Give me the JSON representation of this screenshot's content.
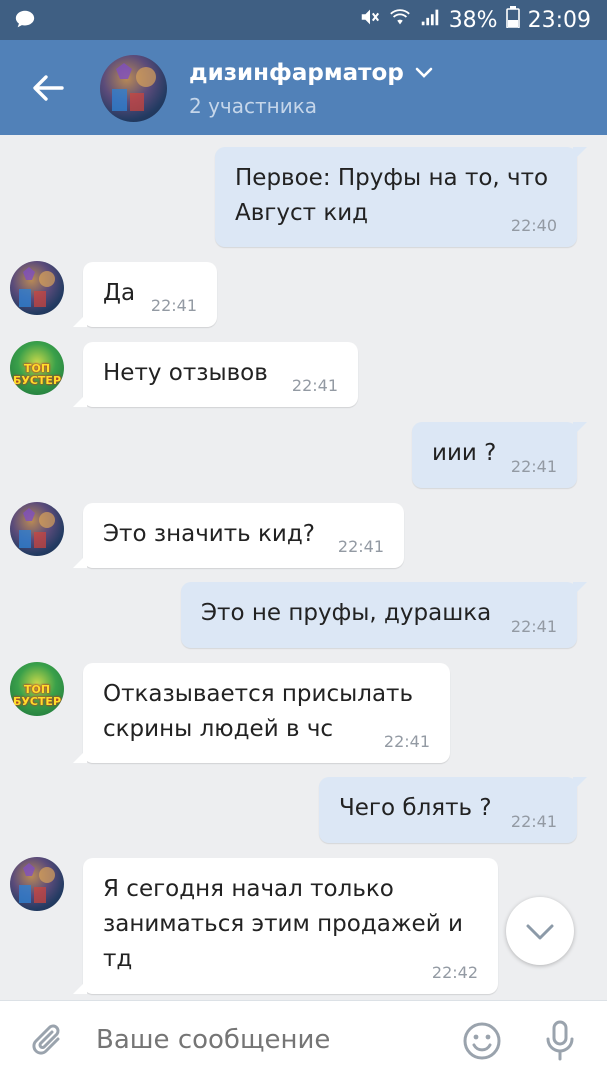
{
  "status_bar": {
    "battery": "38%",
    "time": "23:09"
  },
  "header": {
    "title": "дизинфарматор",
    "subtitle": "2 участника"
  },
  "messages": [
    {
      "dir": "out",
      "lines": [
        "Первое: Пруфы на то, что",
        "Август кид"
      ],
      "time": "22:40"
    },
    {
      "dir": "in",
      "avatar": "a1",
      "lines": [
        "Да"
      ],
      "time": "22:41"
    },
    {
      "dir": "in",
      "avatar": "a2",
      "lines": [
        "Нету отзывов"
      ],
      "time": "22:41"
    },
    {
      "dir": "out",
      "lines": [
        "иии ?"
      ],
      "time": "22:41"
    },
    {
      "dir": "in",
      "avatar": "a1",
      "lines": [
        "Это значить кид?"
      ],
      "time": "22:41"
    },
    {
      "dir": "out",
      "lines": [
        "Это не пруфы, дурашка"
      ],
      "time": "22:41"
    },
    {
      "dir": "in",
      "avatar": "a2",
      "lines": [
        "Отказывается присылать",
        "скрины людей в чс"
      ],
      "time": "22:41"
    },
    {
      "dir": "out",
      "lines": [
        "Чего блять ?"
      ],
      "time": "22:41"
    },
    {
      "dir": "in",
      "avatar": "a1",
      "lines": [
        "Я сегодня начал только",
        "заниматься этим продажей и",
        "тд"
      ],
      "time": "22:42"
    }
  ],
  "avatar_badge": {
    "a2_text": "ТОП БУСТЕР"
  },
  "composer": {
    "placeholder": "Ваше сообщение"
  },
  "icons": {
    "notification": "chat-bubble-icon",
    "mute": "mute-icon",
    "wifi": "wifi-icon",
    "signal": "signal-icon",
    "battery": "battery-icon",
    "back": "arrow-left-icon",
    "dropdown": "chevron-down-icon",
    "scroll": "chevron-down-icon",
    "attach": "paperclip-icon",
    "emoji": "smiley-icon",
    "mic": "microphone-icon"
  },
  "colors": {
    "header": "#5181b8",
    "status_bar": "#3f5f83",
    "background": "#edeef0",
    "bubble_out": "#dce7f5",
    "bubble_in": "#ffffff"
  }
}
